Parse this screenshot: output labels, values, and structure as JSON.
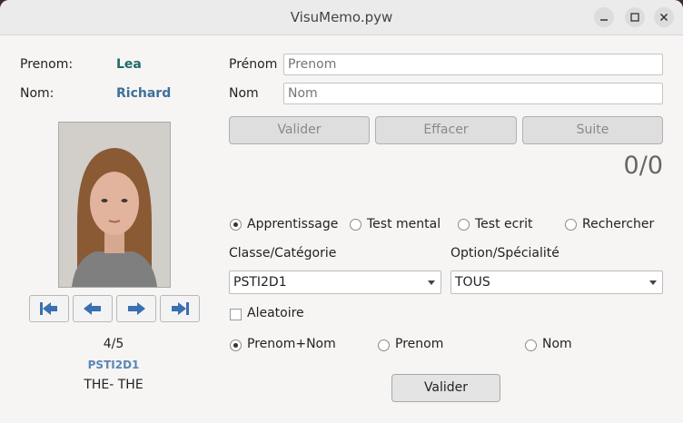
{
  "window": {
    "title": "VisuMemo.pyw"
  },
  "left": {
    "prenom_label": "Prenom:",
    "prenom_value": "Lea",
    "nom_label": "Nom:",
    "nom_value": "Richard",
    "counter": "4/5",
    "classe": "PSTI2D1",
    "option": "THE- THE"
  },
  "form": {
    "prenom_label": "Prénom",
    "prenom_placeholder": "Prenom",
    "nom_label": "Nom",
    "nom_placeholder": "Nom",
    "valider_label": "Valider",
    "effacer_label": "Effacer",
    "suite_label": "Suite",
    "score": "0/0"
  },
  "modes": [
    {
      "label": "Apprentissage",
      "selected": true
    },
    {
      "label": "Test mental",
      "selected": false
    },
    {
      "label": "Test ecrit",
      "selected": false
    },
    {
      "label": "Rechercher",
      "selected": false
    }
  ],
  "filters": {
    "classe_label": "Classe/Catégorie",
    "classe_value": "PSTI2D1",
    "option_label": "Option/Spécialité",
    "option_value": "TOUS",
    "aleatoire_label": "Aleatoire"
  },
  "display": [
    {
      "label": "Prenom+Nom",
      "selected": true
    },
    {
      "label": "Prenom",
      "selected": false
    },
    {
      "label": "Nom",
      "selected": false
    }
  ],
  "footer": {
    "valider_label": "Valider"
  },
  "colors": {
    "prenom_value": "#1f6b6b",
    "nom_value": "#3f6f9a",
    "classe": "#5b86b6",
    "nav_arrow": "#3a6fb0"
  }
}
